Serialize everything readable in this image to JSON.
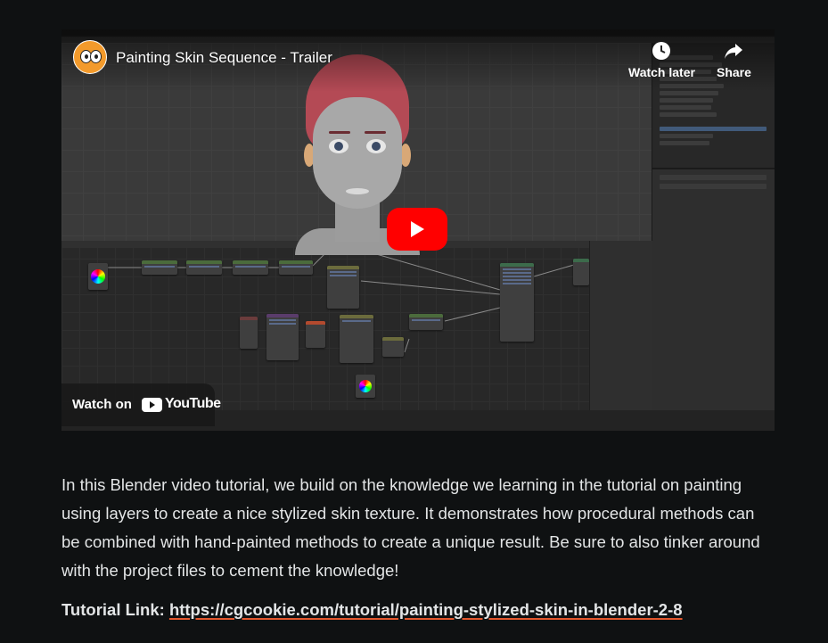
{
  "video": {
    "title": "Painting Skin Sequence - Trailer",
    "actions": [
      {
        "label": "Watch later",
        "icon": "clock-icon"
      },
      {
        "label": "Share",
        "icon": "share-arrow-icon"
      }
    ],
    "watch_on_label": "Watch on",
    "youtube_wordmark": "YouTube",
    "play_icon": "play-icon",
    "play_button_color": "#ff0000"
  },
  "article": {
    "description": "In this Blender video tutorial, we build on the knowledge we learning in the tutorial on painting using layers to create a nice stylized skin texture. It demonstrates how procedural methods can be combined with hand-painted methods to create a unique result. Be sure to also tinker around with the project files to cement the knowledge!",
    "tutorial_link_label": "Tutorial Link:",
    "tutorial_link_url": "https://cgcookie.com/tutorial/painting-stylized-skin-in-blender-2-8"
  },
  "colors": {
    "page_background": "#0f1112",
    "text": "#e3e5e6",
    "link_underline": "#e4572e"
  }
}
